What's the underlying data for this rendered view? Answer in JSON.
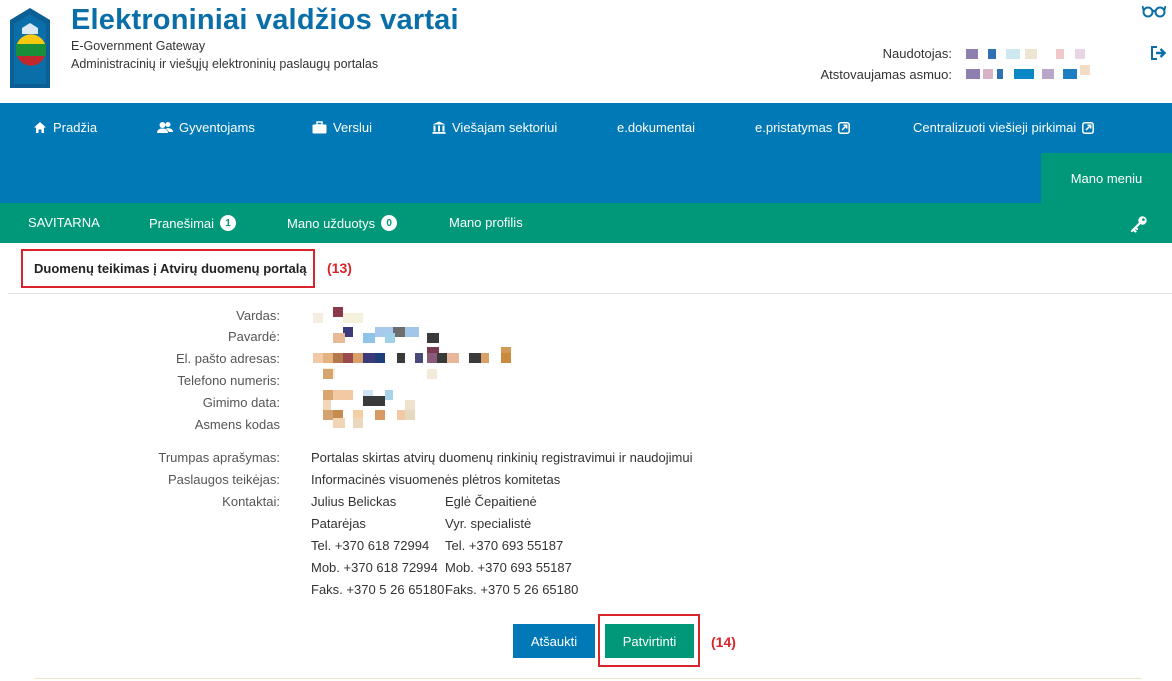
{
  "header": {
    "title": "Elektroniniai valdžios vartai",
    "subtitle_en": "E-Government Gateway",
    "subtitle_lt": "Administracinių ir viešųjų elektroninių paslaugų portalas",
    "user_label": "Naudotojas:",
    "represented_label": "Atstovaujamas asmuo:"
  },
  "main_nav": {
    "items": [
      {
        "label": "Pradžia",
        "icon": "home-icon"
      },
      {
        "label": "Gyventojams",
        "icon": "users-icon"
      },
      {
        "label": "Verslui",
        "icon": "briefcase-icon"
      },
      {
        "label": "Viešajam sektoriui",
        "icon": "institution-icon"
      },
      {
        "label": "e.dokumentai",
        "icon": ""
      },
      {
        "label": "e.pristatymas",
        "icon": "external-link-icon"
      },
      {
        "label": "Centralizuoti viešieji pirkimai",
        "icon": "external-link-icon"
      }
    ],
    "mano_meniu": "Mano meniu"
  },
  "sub_nav": {
    "items": [
      {
        "label": "SAVITARNA"
      },
      {
        "label": "Pranešimai",
        "badge": "1"
      },
      {
        "label": "Mano užduotys",
        "badge": "0"
      },
      {
        "label": "Mano profilis"
      }
    ]
  },
  "page": {
    "title": "Duomenų teikimas į Atvirų duomenų portalą",
    "annotation_title": "(13)",
    "annotation_button": "(14)"
  },
  "form": {
    "fields": [
      {
        "label": "Vardas:"
      },
      {
        "label": "Pavardė:"
      },
      {
        "label": "El. pašto adresas:"
      },
      {
        "label": "Telefono numeris:"
      },
      {
        "label": "Gimimo data:"
      },
      {
        "label": "Asmens kodas"
      }
    ],
    "description_label": "Trumpas aprašymas:",
    "description_value": "Portalas skirtas atvirų duomenų rinkinių registravimui ir naudojimui",
    "provider_label": "Paslaugos teikėjas:",
    "provider_value": "Informacinės visuomenės plėtros komitetas",
    "contacts_label": "Kontaktai:",
    "contacts": [
      {
        "name": "Julius Belickas",
        "role": "Patarėjas",
        "tel": "Tel. +370 618 72994",
        "mob": "Mob. +370 618 72994",
        "fax": "Faks. +370 5 26 65180"
      },
      {
        "name": "Eglė Čepaitienė",
        "role": "Vyr. specialistė",
        "tel": "Tel. +370 693 55187",
        "mob": "Mob. +370 693 55187",
        "fax": "Faks. +370 5 26 65180"
      }
    ]
  },
  "buttons": {
    "cancel": "Atšaukti",
    "confirm": "Patvirtinti"
  },
  "colors": {
    "brand_blue": "#0079b6",
    "brand_green": "#009879",
    "annotation_red": "#d9242b"
  }
}
